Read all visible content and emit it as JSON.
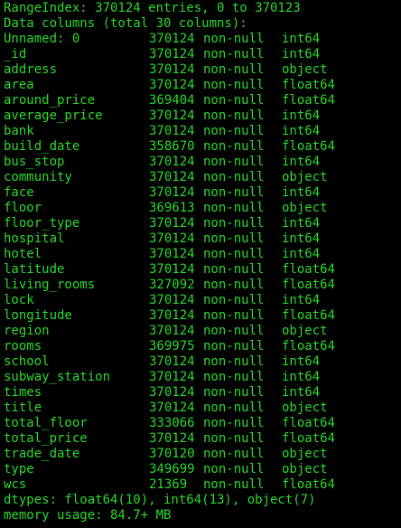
{
  "colors": {
    "background": "#000000",
    "text": "#2bd92b"
  },
  "header": {
    "range_index": "RangeIndex: 370124 entries, 0 to 370123",
    "data_columns": "Data columns (total 30 columns):"
  },
  "columns": [
    {
      "name": "Unnamed: 0",
      "count": "370124",
      "nullability": "non-null",
      "dtype": "int64"
    },
    {
      "name": "_id",
      "count": "370124",
      "nullability": "non-null",
      "dtype": "int64"
    },
    {
      "name": "address",
      "count": "370124",
      "nullability": "non-null",
      "dtype": "object"
    },
    {
      "name": "area",
      "count": "370124",
      "nullability": "non-null",
      "dtype": "float64"
    },
    {
      "name": "around_price",
      "count": "369404",
      "nullability": "non-null",
      "dtype": "float64"
    },
    {
      "name": "average_price",
      "count": "370124",
      "nullability": "non-null",
      "dtype": "int64"
    },
    {
      "name": "bank",
      "count": "370124",
      "nullability": "non-null",
      "dtype": "int64"
    },
    {
      "name": "build_date",
      "count": "358670",
      "nullability": "non-null",
      "dtype": "float64"
    },
    {
      "name": "bus_stop",
      "count": "370124",
      "nullability": "non-null",
      "dtype": "int64"
    },
    {
      "name": "community",
      "count": "370124",
      "nullability": "non-null",
      "dtype": "object"
    },
    {
      "name": "face",
      "count": "370124",
      "nullability": "non-null",
      "dtype": "int64"
    },
    {
      "name": "floor",
      "count": "369613",
      "nullability": "non-null",
      "dtype": "object"
    },
    {
      "name": "floor_type",
      "count": "370124",
      "nullability": "non-null",
      "dtype": "int64"
    },
    {
      "name": "hospital",
      "count": "370124",
      "nullability": "non-null",
      "dtype": "int64"
    },
    {
      "name": "hotel",
      "count": "370124",
      "nullability": "non-null",
      "dtype": "int64"
    },
    {
      "name": "latitude",
      "count": "370124",
      "nullability": "non-null",
      "dtype": "float64"
    },
    {
      "name": "living_rooms",
      "count": "327092",
      "nullability": "non-null",
      "dtype": "float64"
    },
    {
      "name": "lock",
      "count": "370124",
      "nullability": "non-null",
      "dtype": "int64"
    },
    {
      "name": "longitude",
      "count": "370124",
      "nullability": "non-null",
      "dtype": "float64"
    },
    {
      "name": "region",
      "count": "370124",
      "nullability": "non-null",
      "dtype": "object"
    },
    {
      "name": "rooms",
      "count": "369975",
      "nullability": "non-null",
      "dtype": "float64"
    },
    {
      "name": "school",
      "count": "370124",
      "nullability": "non-null",
      "dtype": "int64"
    },
    {
      "name": "subway_station",
      "count": "370124",
      "nullability": "non-null",
      "dtype": "int64"
    },
    {
      "name": "times",
      "count": "370124",
      "nullability": "non-null",
      "dtype": "int64"
    },
    {
      "name": "title",
      "count": "370124",
      "nullability": "non-null",
      "dtype": "object"
    },
    {
      "name": "total_floor",
      "count": "333066",
      "nullability": "non-null",
      "dtype": "float64"
    },
    {
      "name": "total_price",
      "count": "370124",
      "nullability": "non-null",
      "dtype": "float64"
    },
    {
      "name": "trade_date",
      "count": "370120",
      "nullability": "non-null",
      "dtype": "object"
    },
    {
      "name": "type",
      "count": "349699",
      "nullability": "non-null",
      "dtype": "object"
    },
    {
      "name": "wcs",
      "count": "21369",
      "nullability": "non-null",
      "dtype": "float64"
    }
  ],
  "footer": {
    "dtypes": "dtypes: float64(10), int64(13), object(7)",
    "memory_usage": "memory usage: 84.7+ MB"
  }
}
